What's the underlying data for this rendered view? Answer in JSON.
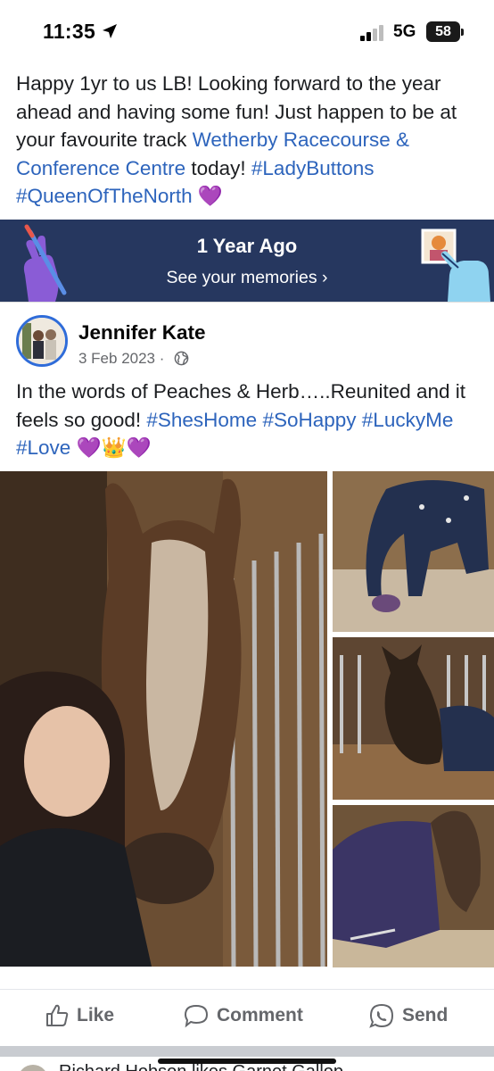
{
  "status_bar": {
    "time": "11:35",
    "network": "5G",
    "battery": "58"
  },
  "post": {
    "caption_before_link": "Happy 1yr to us LB! Looking forward to the year ahead and having some fun! Just happen to be at your favourite track ",
    "caption_link": "Wetherby Racecourse & Conference Centre",
    "caption_after_link": " today! ",
    "hashtags": [
      "#LadyButtons",
      "#QueenOfTheNorth"
    ],
    "emoji": "💜"
  },
  "memories": {
    "title": "1 Year Ago",
    "subtitle": "See your memories",
    "chevron": "›"
  },
  "shared_post": {
    "author": "Jennifer Kate",
    "date": "3 Feb 2023",
    "separator": "·",
    "text_before": "In the words of Peaches & Herb…..Reunited and it feels so good! ",
    "hashtags": [
      "#ShesHome",
      "#SoHappy",
      "#LuckyMe",
      "#Love"
    ],
    "emojis": "💜👑💜"
  },
  "actions": {
    "like": "Like",
    "comment": "Comment",
    "send": "Send"
  },
  "next_story": {
    "text": "Richard Hobson likes Garnet Gallop"
  },
  "colors": {
    "link": "#2d64bc",
    "memories_bg": "#26375f",
    "action_grey": "#65676b"
  },
  "icons": [
    "location-arrow-icon",
    "signal-icon",
    "globe-icon",
    "like-icon",
    "comment-icon",
    "send-icon",
    "chevron-right-icon"
  ]
}
